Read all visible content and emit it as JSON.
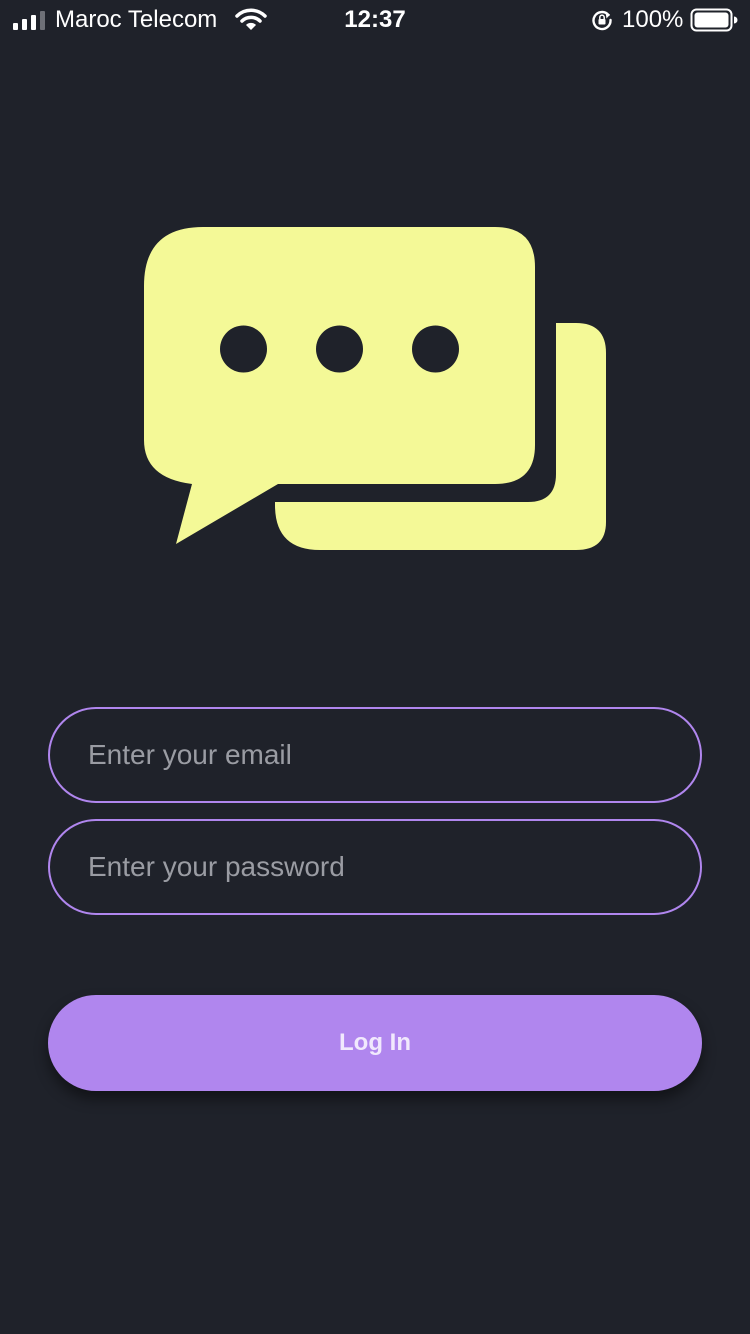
{
  "status_bar": {
    "carrier": "Maroc Telecom",
    "time": "12:37",
    "battery_percent": "100%",
    "icons": [
      "signal-bars-icon",
      "wifi-icon",
      "rotation-lock-icon",
      "battery-icon"
    ]
  },
  "logo": {
    "icon": "chat-bubbles-icon",
    "color": "#f4f997"
  },
  "form": {
    "email_placeholder": "Enter your email",
    "email_value": "",
    "password_placeholder": "Enter your password",
    "password_value": "",
    "login_label": "Log In"
  },
  "colors": {
    "background": "#1f222a",
    "accent": "#b086ee",
    "logo": "#f4f997"
  }
}
